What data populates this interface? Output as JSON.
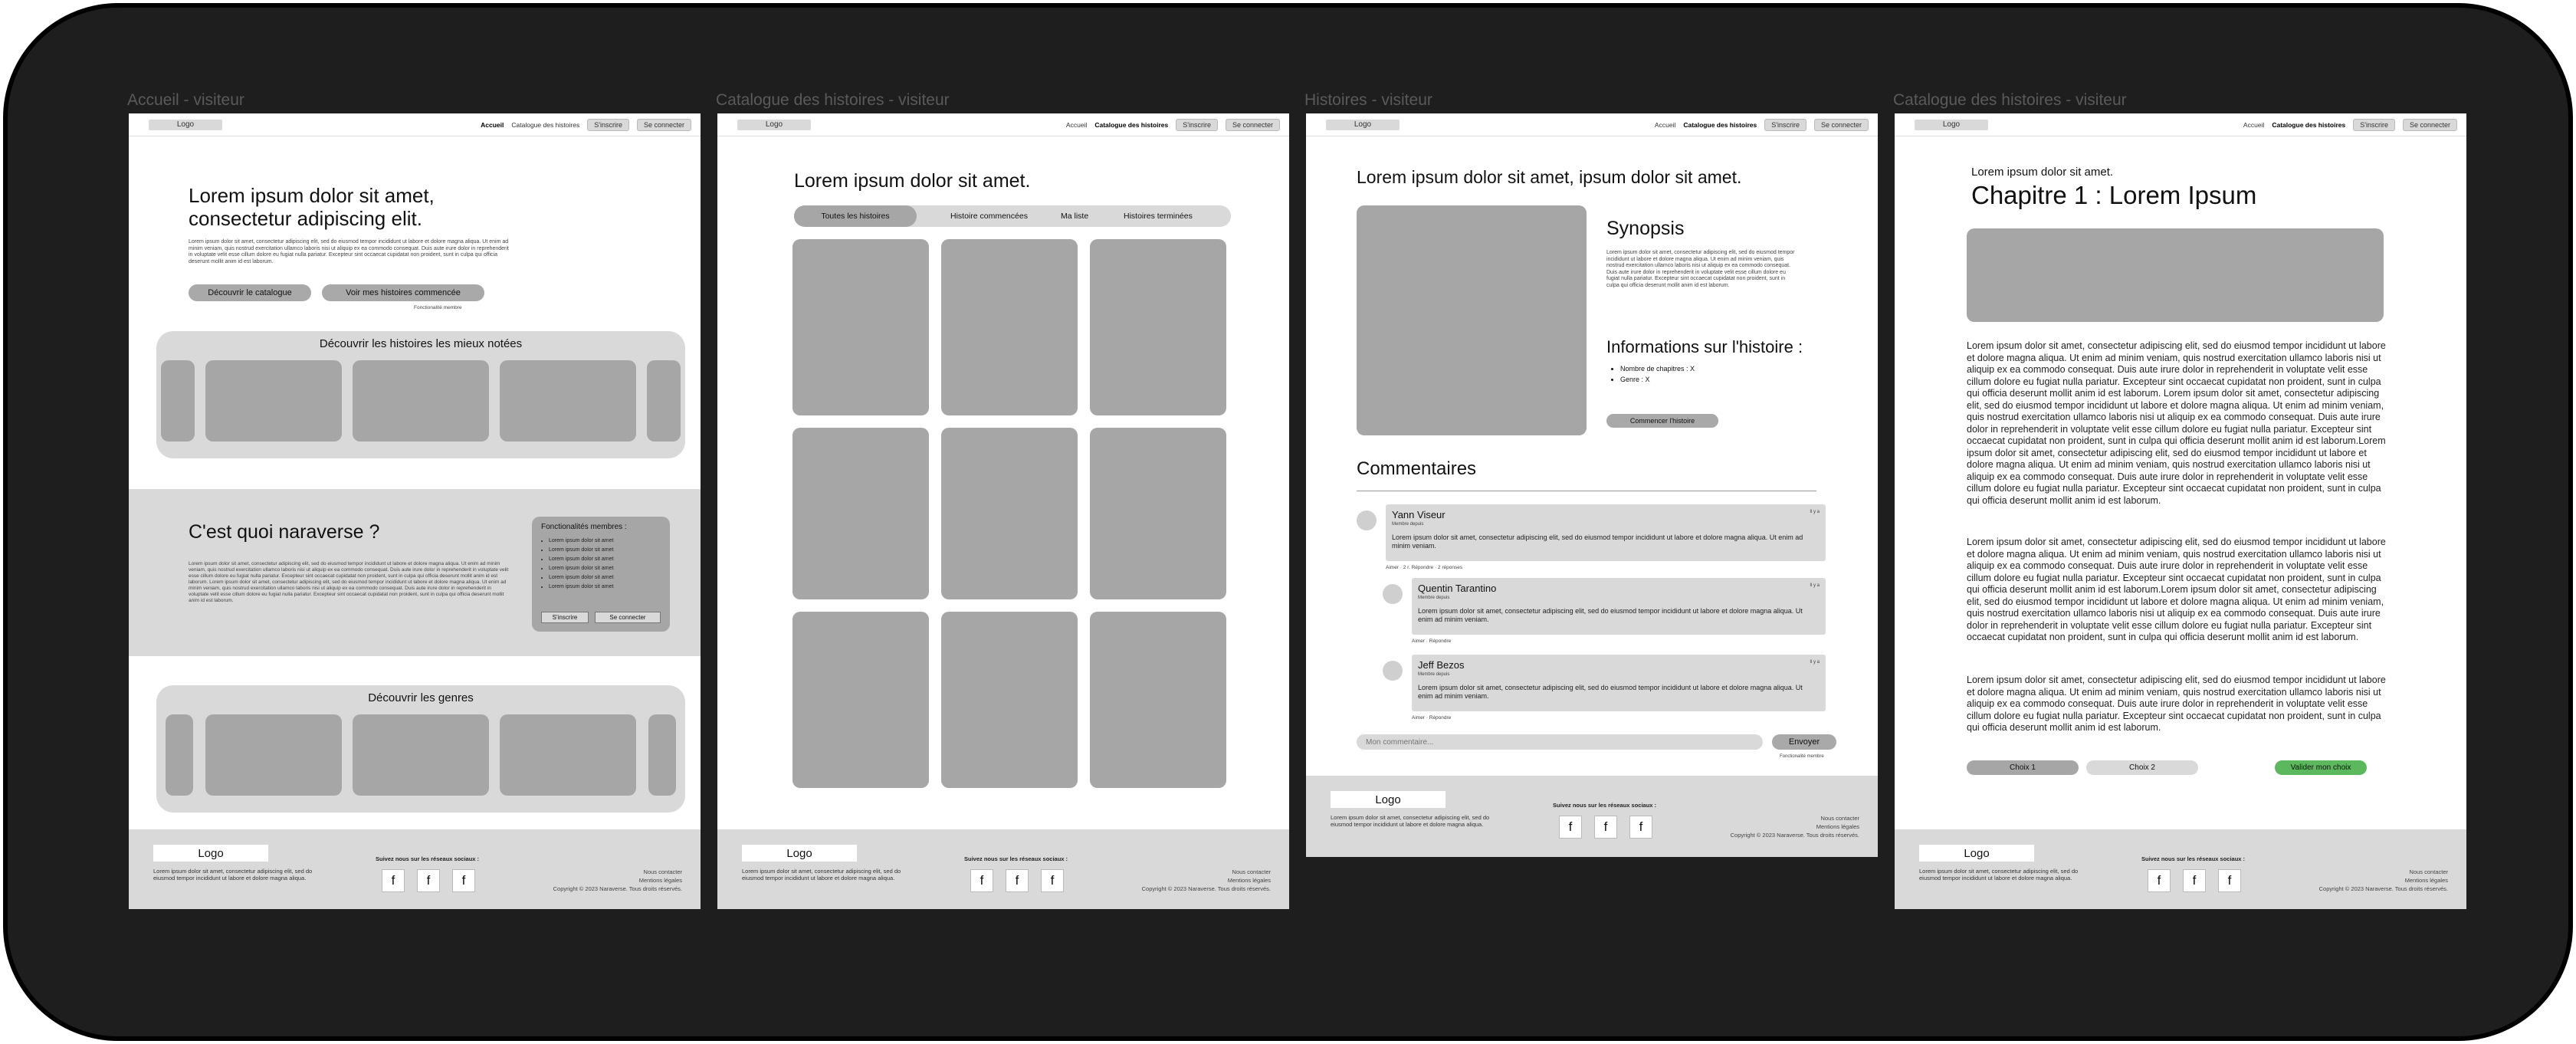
{
  "frames": {
    "f1": {
      "label": "Accueil - visiteur",
      "nav": {
        "logo": "Logo",
        "links": [
          "Accueil",
          "Catalogue des histoires"
        ],
        "btn1": "S'inscrire",
        "btn2": "Se connecter"
      },
      "hero": {
        "title": "Lorem ipsum dolor sit amet, consectetur adipiscing elit.",
        "body": "Lorem ipsum dolor sit amet, consectetur adipiscing elit, sed do eiusmod tempor incididunt ut labore et dolore magna aliqua. Ut enim ad minim veniam, quis nostrud exercitation ullamco laboris nisi ut aliquip ex ea commodo consequat. Duis aute irure dolor in reprehenderit in voluptate velit esse cillum dolore eu fugiat nulla pariatur. Excepteur sint occaecat cupidatat non proident, sunt in culpa qui officia deserunt mollit anim id est laborum.",
        "btn1": "Découvrir le catalogue",
        "btn2": "Voir mes histoires commencée",
        "note": "Fonctionalité membre"
      },
      "top_rated": {
        "title": "Découvrir les histoires les mieux notées"
      },
      "about": {
        "title": "C'est quoi naraverse ?",
        "body": "Lorem ipsum dolor sit amet, consectetur adipiscing elit, sed do eiusmod tempor incididunt ut labore et dolore magna aliqua. Ut enim ad minim veniam, quis nostrud exercitation ullamco laboris nisi ut aliquip ex ea commodo consequat. Duis aute irure dolor in reprehenderit in voluptate velit esse cillum dolore eu fugiat nulla pariatur. Excepteur sint occaecat cupidatat non proident, sunt in culpa qui officia deserunt mollit anim id est laborum. Lorem ipsum dolor sit amet, consectetur adipiscing elit, sed do eiusmod tempor incididunt ut labore et dolore magna aliqua. Ut enim ad minim veniam, quis nostrud exercitation ullamco laboris nisi ut aliquip ex ea commodo consequat. Duis aute irure dolor in reprehenderit in voluptate velit esse cillum dolore eu fugiat nulla pariatur. Excepteur sint occaecat cupidatat non proident, sunt in culpa qui officia deserunt mollit anim id est laborum.",
        "features_title": "Fonctionalités membres :",
        "features": [
          "Lorem ipsum dolor sit amet",
          "Lorem ipsum dolor sit amet",
          "Lorem ipsum dolor sit amet",
          "Lorem ipsum dolor sit amet",
          "Lorem ipsum dolor sit amet",
          "Lorem ipsum dolor sit amet"
        ],
        "btn1": "S'inscrire",
        "btn2": "Se connecter"
      },
      "genres": {
        "title": "Découvrir les genres"
      }
    },
    "f2": {
      "label": "Catalogue des histoires - visiteur",
      "nav": {
        "logo": "Logo",
        "links": [
          "Accueil",
          "Catalogue des histoires"
        ],
        "btn1": "S'inscrire",
        "btn2": "Se connecter"
      },
      "title": "Lorem ipsum dolor sit amet.",
      "tabs": [
        "Toutes les histoires",
        "Histoire commencées",
        "Ma liste",
        "Histoires terminées"
      ]
    },
    "f3": {
      "label": "Histoires - visiteur",
      "nav": {
        "logo": "Logo",
        "links": [
          "Accueil",
          "Catalogue des histoires"
        ],
        "btn1": "S'inscrire",
        "btn2": "Se connecter"
      },
      "title": "Lorem ipsum dolor sit amet, ipsum dolor sit amet.",
      "synopsis_title": "Synopsis",
      "synopsis_body": "Lorem ipsum dolor sit amet, consectetur adipiscing elit, sed do eiusmod tempor incididunt ut labore et dolore magna aliqua. Ut enim ad minim veniam, quis nostrud exercitation ullamco laboris nisi ut aliquip ex ea commodo consequat. Duis aute irure dolor in reprehenderit in voluptate velit esse cillum dolore eu fugiat nulla pariatur. Excepteur sint occaecat cupidatat non proident, sunt in culpa qui officia deserunt mollit anim id est laborum.",
      "info_title": "Informations sur l'histoire :",
      "info_items": [
        "Nombre de chapitres : X",
        "Genre : X"
      ],
      "start_btn": "Commencer l'histoire",
      "comments_title": "Commentaires",
      "comments": [
        {
          "name": "Yann Viseur",
          "sub": "Membre depuis",
          "time": "Il y a",
          "text": "Lorem ipsum dolor sit amet, consectetur adipiscing elit, sed do eiusmod tempor incididunt ut labore et dolore magna aliqua. Ut enim ad minim veniam.",
          "actions": "Aimer · 2 r. Répondre · 2 réponses"
        },
        {
          "name": "Quentin Tarantino",
          "sub": "Membre depuis",
          "time": "Il y a",
          "text": "Lorem ipsum dolor sit amet, consectetur adipiscing elit, sed do eiusmod tempor incididunt ut labore et dolore magna aliqua. Ut enim ad minim veniam.",
          "actions": "Aimer · Répondre"
        },
        {
          "name": "Jeff Bezos",
          "sub": "Membre depuis",
          "time": "Il y a",
          "text": "Lorem ipsum dolor sit amet, consectetur adipiscing elit, sed do eiusmod tempor incididunt ut labore et dolore magna aliqua. Ut enim ad minim veniam.",
          "actions": "Aimer · Répondre"
        }
      ],
      "comment_placeholder": "Mon commentaire...",
      "send_btn": "Envoyer",
      "send_note": "Fonctionalité membre"
    },
    "f4": {
      "label": "Catalogue des histoires - visiteur",
      "nav": {
        "logo": "Logo",
        "links": [
          "Accueil",
          "Catalogue des histoires"
        ],
        "btn1": "S'inscrire",
        "btn2": "Se connecter"
      },
      "subtitle": "Lorem ipsum dolor sit amet.",
      "title": "Chapitre 1 : Lorem Ipsum",
      "paragraphs": [
        "Lorem ipsum dolor sit amet, consectetur adipiscing elit, sed do eiusmod tempor incididunt ut labore et dolore magna aliqua. Ut enim ad minim veniam, quis nostrud exercitation ullamco laboris nisi ut aliquip ex ea commodo consequat. Duis aute irure dolor in reprehenderit in voluptate velit esse cillum dolore eu fugiat nulla pariatur. Excepteur sint occaecat cupidatat non proident, sunt in culpa qui officia deserunt mollit anim id est laborum. Lorem ipsum dolor sit amet, consectetur adipiscing elit, sed do eiusmod tempor incididunt ut labore et dolore magna aliqua. Ut enim ad minim veniam, quis nostrud exercitation ullamco laboris nisi ut aliquip ex ea commodo consequat. Duis aute irure dolor in reprehenderit in voluptate velit esse cillum dolore eu fugiat nulla pariatur. Excepteur sint occaecat cupidatat non proident, sunt in culpa qui officia deserunt mollit anim id est laborum.Lorem ipsum dolor sit amet, consectetur adipiscing elit, sed do eiusmod tempor incididunt ut labore et dolore magna aliqua. Ut enim ad minim veniam, quis nostrud exercitation ullamco laboris nisi ut aliquip ex ea commodo consequat. Duis aute irure dolor in reprehenderit in voluptate velit esse cillum dolore eu fugiat nulla pariatur. Excepteur sint occaecat cupidatat non proident, sunt in culpa qui officia deserunt mollit anim id est laborum.",
        "Lorem ipsum dolor sit amet, consectetur adipiscing elit, sed do eiusmod tempor incididunt ut labore et dolore magna aliqua. Ut enim ad minim veniam, quis nostrud exercitation ullamco laboris nisi ut aliquip ex ea commodo consequat. Duis aute irure dolor in reprehenderit in voluptate velit esse cillum dolore eu fugiat nulla pariatur. Excepteur sint occaecat cupidatat non proident, sunt in culpa qui officia deserunt mollit anim id est laborum.Lorem ipsum dolor sit amet, consectetur adipiscing elit, sed do eiusmod tempor incididunt ut labore et dolore magna aliqua. Ut enim ad minim veniam, quis nostrud exercitation ullamco laboris nisi ut aliquip ex ea commodo consequat. Duis aute irure dolor in reprehenderit in voluptate velit esse cillum dolore eu fugiat nulla pariatur. Excepteur sint occaecat cupidatat non proident, sunt in culpa qui officia deserunt mollit anim id est laborum.",
        "Lorem ipsum dolor sit amet, consectetur adipiscing elit, sed do eiusmod tempor incididunt ut labore et dolore magna aliqua. Ut enim ad minim veniam, quis nostrud exercitation ullamco laboris nisi ut aliquip ex ea commodo consequat. Duis aute irure dolor in reprehenderit in voluptate velit esse cillum dolore eu fugiat nulla pariatur. Excepteur sint occaecat cupidatat non proident, sunt in culpa qui officia deserunt mollit anim id est laborum."
      ],
      "choice1": "Choix 1",
      "choice2": "Choix 2",
      "validate": "Valider mon choix"
    }
  },
  "footer": {
    "logo": "Logo",
    "desc": "Lorem ipsum dolor sit amet, consectetur adipiscing elit, sed do eiusmod tempor incididunt ut labore et dolore magna aliqua.",
    "social_title": "Suivez nous sur les réseaux sociaux :",
    "social_icon": "f",
    "contact": "Nous contacter",
    "legal": "Mentions légales",
    "copyright": "Copyright © 2023 Naraverse. Tous droits réservés."
  },
  "colors": {
    "accent_green": "#5cb85c",
    "block_gray": "#a6a6a6",
    "light_gray": "#d9d9d9",
    "background": "#1e1e1e"
  }
}
